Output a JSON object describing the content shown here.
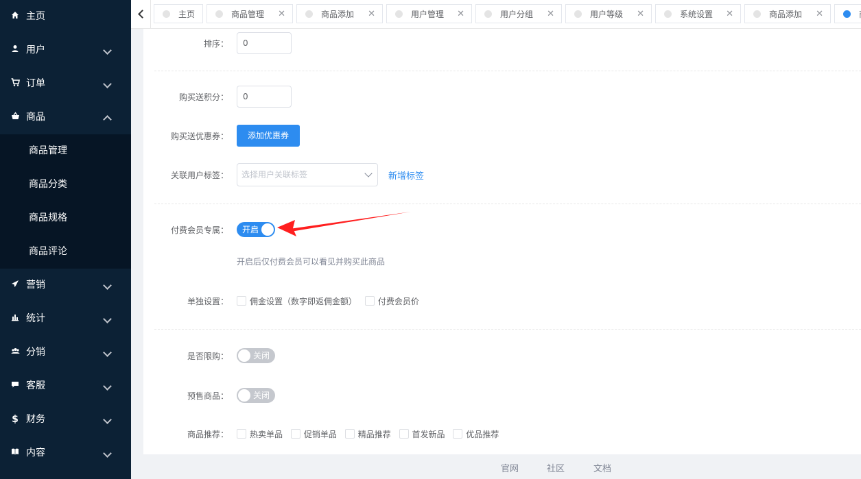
{
  "sidebar": {
    "items": [
      {
        "label": "主页",
        "icon": "home-icon"
      },
      {
        "label": "用户",
        "icon": "user-icon"
      },
      {
        "label": "订单",
        "icon": "cart-icon"
      },
      {
        "label": "商品",
        "icon": "basket-icon",
        "expanded": true,
        "children": [
          "商品管理",
          "商品分类",
          "商品规格",
          "商品评论"
        ]
      },
      {
        "label": "营销",
        "icon": "paper-plane-icon"
      },
      {
        "label": "统计",
        "icon": "bar-chart-icon"
      },
      {
        "label": "分销",
        "icon": "group-icon"
      },
      {
        "label": "客服",
        "icon": "chat-icon"
      },
      {
        "label": "财务",
        "icon": "dollar-icon"
      },
      {
        "label": "内容",
        "icon": "book-icon"
      }
    ]
  },
  "tabs": [
    {
      "label": "主页",
      "closable": false
    },
    {
      "label": "商品管理",
      "closable": true
    },
    {
      "label": "商品添加",
      "closable": true
    },
    {
      "label": "用户管理",
      "closable": true
    },
    {
      "label": "用户分组",
      "closable": true
    },
    {
      "label": "用户等级",
      "closable": true
    },
    {
      "label": "系统设置",
      "closable": true
    },
    {
      "label": "商品添加",
      "closable": true
    },
    {
      "label": "商",
      "closable": false,
      "active": true
    }
  ],
  "form": {
    "sort": {
      "label": "排序：",
      "value": "0"
    },
    "points": {
      "label": "购买送积分：",
      "value": "0"
    },
    "coupon": {
      "label": "购买送优惠券：",
      "button": "添加优惠券"
    },
    "user_tags": {
      "label": "关联用户标签：",
      "placeholder": "选择用户关联标签",
      "link": "新增标签"
    },
    "vip_only": {
      "label": "付费会员专属：",
      "state": "开启",
      "on": true,
      "hint": "开启后仅付费会员可以看见并购买此商品"
    },
    "individual": {
      "label": "单独设置：",
      "options": [
        "佣金设置（数字即返佣金额）",
        "付费会员价"
      ]
    },
    "limit": {
      "label": "是否限购：",
      "state": "关闭",
      "on": false
    },
    "presale": {
      "label": "预售商品：",
      "state": "关闭",
      "on": false
    },
    "recommend": {
      "label": "商品推荐：",
      "options": [
        "热卖单品",
        "促销单品",
        "精品推荐",
        "首发新品",
        "优品推荐"
      ]
    }
  },
  "footer": {
    "links": [
      "官网",
      "社区",
      "文档"
    ]
  },
  "colors": {
    "sidebar_bg": "#0c2135",
    "submenu_bg": "#061525",
    "primary": "#2d8cf0",
    "annotation_arrow": "#ff1f1f"
  }
}
